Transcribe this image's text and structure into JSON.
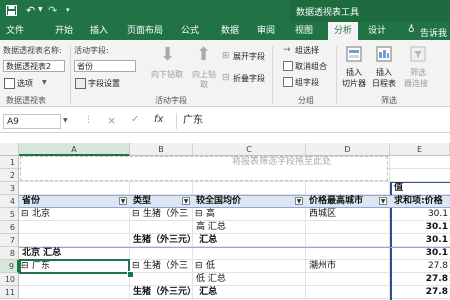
{
  "window": {
    "file_tab": "文件",
    "qat": {
      "save": "save-icon",
      "undo": "undo-icon",
      "redo": "redo-icon"
    },
    "context_title": "数据透视表工具"
  },
  "tabs": [
    "开始",
    "插入",
    "页面布局",
    "公式",
    "数据",
    "审阅",
    "视图",
    "分析",
    "设计"
  ],
  "active_tab": "分析",
  "tell_me": "告诉我",
  "ribbon": {
    "pivot_name_label": "数据透视表名称:",
    "pivot_name_value": "数据透视表2",
    "options_label": "选项",
    "active_field_label": "活动字段:",
    "active_field_value": "省份",
    "field_settings": "字段设置",
    "drill_down": "向下钻取",
    "drill_up": "向上钻",
    "drill_up2": "取",
    "expand_field": "展开字段",
    "collapse_field": "折叠字段",
    "group_selection": "组选择",
    "ungroup": "取消组合",
    "group_field": "组字段",
    "insert_slicer": "插入",
    "insert_slicer2": "切片器",
    "insert_timeline": "插入",
    "insert_timeline2": "日程表",
    "filter_conn": "筛选",
    "filter_conn2": "器连接",
    "group_pivot": "数据透视表",
    "group_active": "活动字段",
    "group_group": "分组",
    "group_filter": "筛选"
  },
  "formula": {
    "name_box": "A9",
    "cancel": "×",
    "enter": "✓",
    "fx": "fx",
    "value": "广东"
  },
  "columns": [
    "A",
    "B",
    "C",
    "D",
    "E"
  ],
  "rows": [
    "1",
    "2",
    "3",
    "4",
    "5",
    "6",
    "7",
    "8",
    "9",
    "10",
    "11"
  ],
  "grid": {
    "report_filter_hint": "将报表筛选字段拖至此处",
    "values_header": "值",
    "col_headers": [
      "省份",
      "类型",
      "较全国均价",
      "价格最高城市",
      "求和项:价格"
    ],
    "rows": [
      {
        "a": "北京",
        "a_sym": "⊟",
        "b": "生猪（外三",
        "b_sym": "⊟",
        "c": "高",
        "c_sym": "⊟",
        "d": "西城区",
        "e": "30.1"
      },
      {
        "a": "",
        "b": "",
        "c": "高 汇总",
        "d": "",
        "e": "30.1"
      },
      {
        "a": "",
        "b": "生猪（外三元） 汇总",
        "c": "",
        "d": "",
        "e": "30.1"
      },
      {
        "a": "北京 汇总",
        "b": "",
        "c": "",
        "d": "",
        "e": "30.1"
      },
      {
        "a": "广东",
        "a_sym": "⊟",
        "b": "生猪（外三",
        "b_sym": "⊟",
        "c": "低",
        "c_sym": "⊟",
        "d": "潮州市",
        "e": "27.8"
      },
      {
        "a": "",
        "b": "",
        "c": "低 汇总",
        "d": "",
        "e": "27.8"
      },
      {
        "a": "",
        "b": "生猪（外三元） 汇总",
        "c": "",
        "d": "",
        "e": "27.8"
      }
    ]
  },
  "colors": {
    "excel_green": "#217346",
    "header_blue": "#dde7f3",
    "selection": "#217346"
  }
}
